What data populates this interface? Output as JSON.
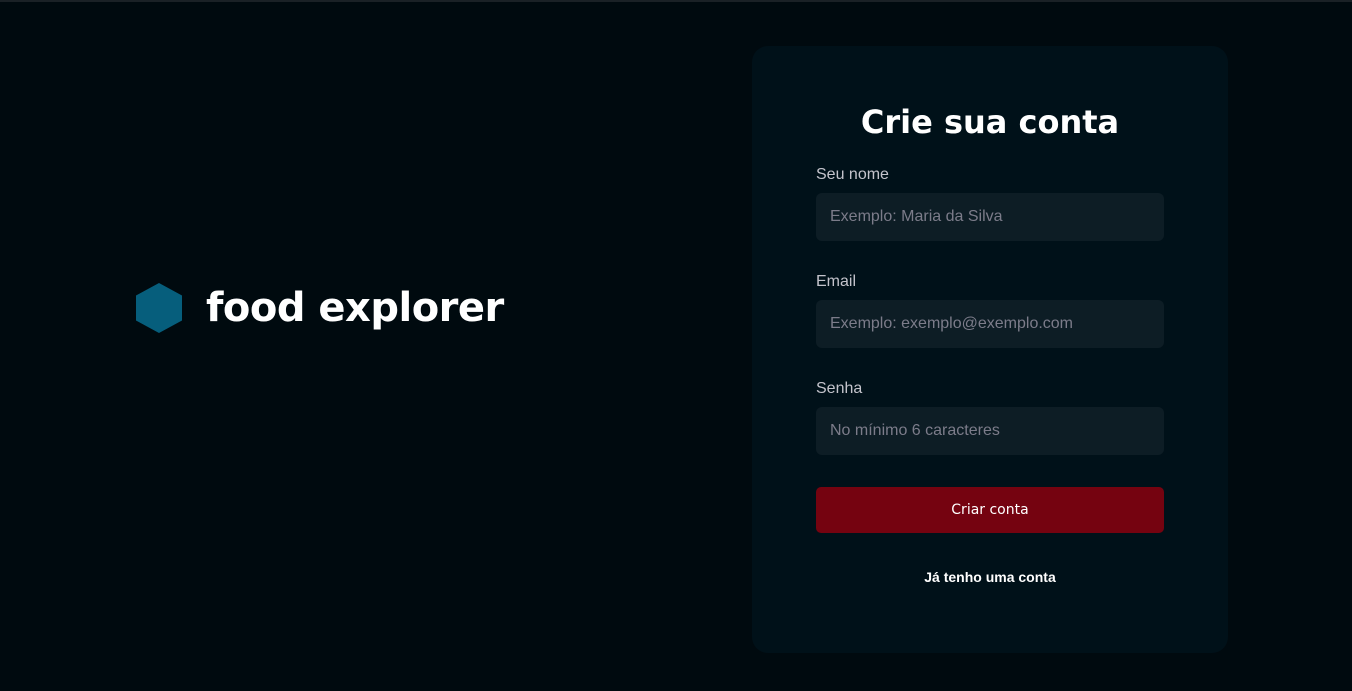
{
  "brand": {
    "name": "food explorer",
    "icon": "hexagon-icon",
    "icon_color": "#065E7C"
  },
  "form": {
    "title": "Crie sua conta",
    "fields": [
      {
        "label": "Seu nome",
        "placeholder": "Exemplo: Maria da Silva",
        "value": ""
      },
      {
        "label": "Email",
        "placeholder": "Exemplo: exemplo@exemplo.com",
        "value": ""
      },
      {
        "label": "Senha",
        "placeholder": "No mínimo 6 caracteres",
        "value": ""
      }
    ],
    "submit_label": "Criar conta",
    "login_link": "Já tenho uma conta"
  },
  "colors": {
    "background": "#000A0F",
    "card": "#001119",
    "input": "#0D1D25",
    "button": "#750310"
  }
}
